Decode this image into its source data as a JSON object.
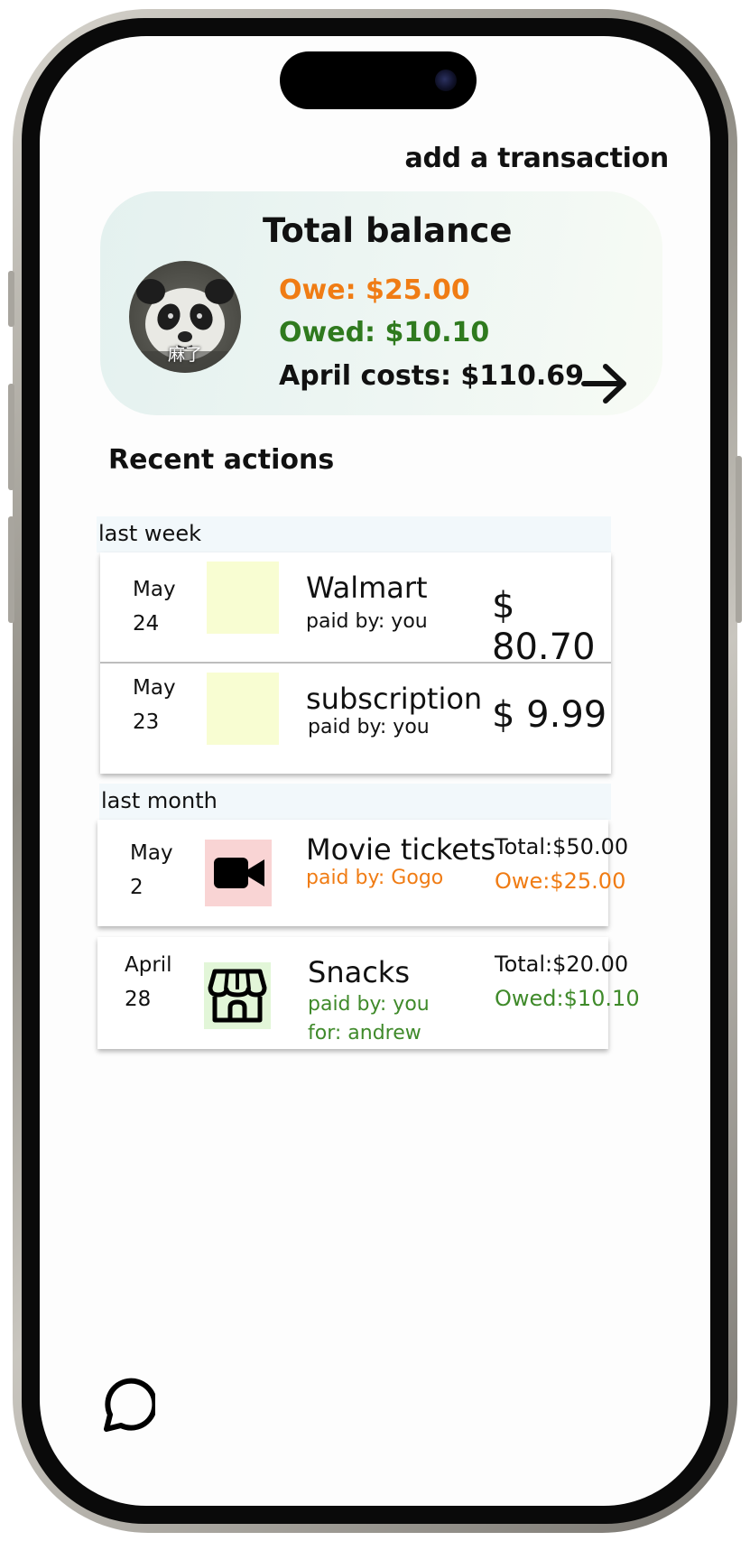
{
  "header": {
    "add_transaction_label": "add a transaction"
  },
  "balance_card": {
    "title": "Total balance",
    "avatar_caption": "麻了",
    "owe": "Owe: $25.00",
    "owed": "Owed: $10.10",
    "month_costs": "April costs: $110.69",
    "arrow_icon": "arrow-right-icon"
  },
  "recent": {
    "title": "Recent actions",
    "groups": [
      {
        "label": "last week",
        "items": [
          {
            "month": "May",
            "day": "24",
            "title": "Walmart",
            "paid_by": "paid by: you",
            "amount": "$ 80.70",
            "thumb_color": "#f8fdd2"
          },
          {
            "month": "May",
            "day": "23",
            "title": "subscription",
            "paid_by": "paid by: you",
            "amount": "$ 9.99",
            "thumb_color": "#f8fdd2"
          }
        ]
      },
      {
        "label": "last month",
        "items": [
          {
            "month": "May",
            "day": "2",
            "title": "Movie tickets",
            "paid_by": "paid by: Gogo",
            "total": "Total:$50.00",
            "balance": "Owe:$25.00",
            "icon": "video-camera-icon",
            "thumb_color": "#f9d4d4"
          },
          {
            "month": "April",
            "day": "28",
            "title": "Snacks",
            "paid_by": "paid by: you",
            "for": "for: andrew",
            "total": "Total:$20.00",
            "balance": "Owed:$10.10",
            "icon": "store-icon",
            "thumb_color": "#e2f6d8"
          }
        ]
      }
    ]
  },
  "bottom": {
    "chat_icon": "chat-bubble-icon"
  },
  "colors": {
    "owe": "#f07c14",
    "owed": "#2f7a1e",
    "card_bg": "#e4f1ef",
    "section_label_bg": "#f2f8fb"
  }
}
